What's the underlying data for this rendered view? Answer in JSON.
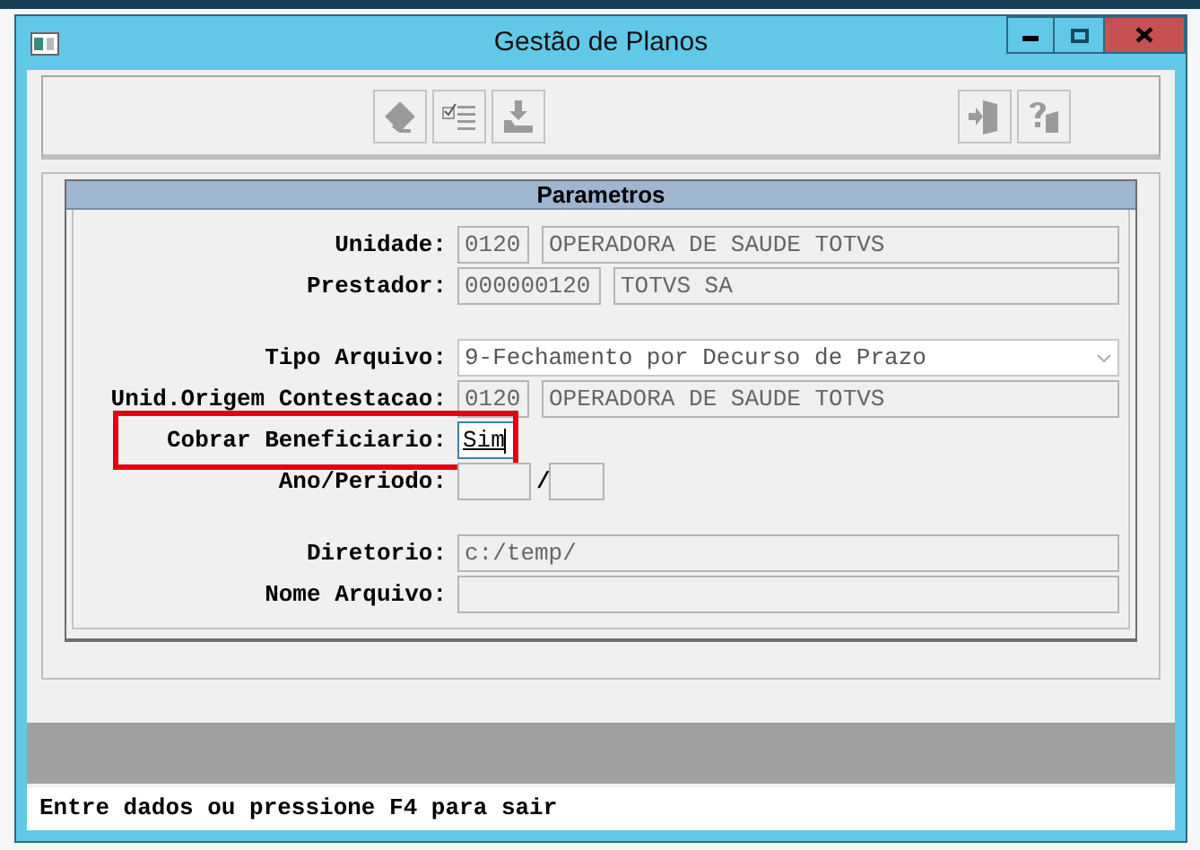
{
  "window": {
    "title": "Gestão de Planos"
  },
  "panel": {
    "title": "Parametros"
  },
  "field_groups": [
    [
      {
        "label": "Unidade:",
        "kind": "unit",
        "values": [
          "0120",
          "OPERADORA DE SAUDE TOTVS"
        ],
        "highlighted": false
      },
      {
        "label": "Prestador:",
        "kind": "provider",
        "values": [
          "000000120",
          "TOTVS SA"
        ],
        "highlighted": false
      }
    ],
    [
      {
        "label": "Tipo Arquivo:",
        "kind": "select",
        "values": [
          "9-Fechamento por Decurso de Prazo"
        ],
        "highlighted": false
      },
      {
        "label": "Unid.Origem Contestacao:",
        "kind": "unit",
        "values": [
          "0120",
          "OPERADORA DE SAUDE TOTVS"
        ],
        "highlighted": false
      },
      {
        "label": "Cobrar Beneficiario:",
        "kind": "flag",
        "values": [
          "Sim"
        ],
        "highlighted": true
      },
      {
        "label": "Ano/Periodo:",
        "kind": "period",
        "separator": "/",
        "highlighted": false
      }
    ],
    [
      {
        "label": "Diretorio:",
        "kind": "text",
        "values": [
          "c:/temp/"
        ],
        "highlighted": false
      },
      {
        "label": "Nome Arquivo:",
        "kind": "text",
        "highlighted": false
      }
    ]
  ],
  "status_bar": {
    "message": "Entre dados ou pressione F4 para sair"
  }
}
